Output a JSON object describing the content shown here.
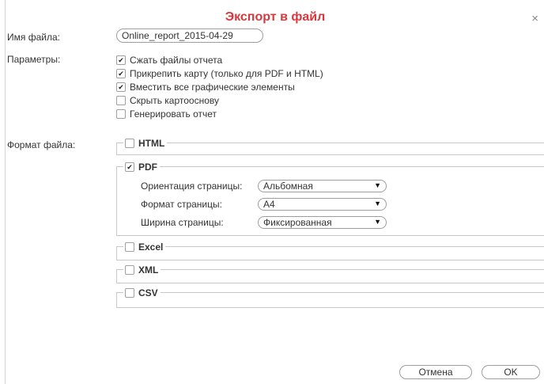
{
  "dialog": {
    "title": "Экспорт в файл",
    "close_symbol": "×"
  },
  "file_name": {
    "label": "Имя файла:",
    "value": "Online_report_2015-04-29"
  },
  "parameters": {
    "label": "Параметры:",
    "options": [
      {
        "label": "Сжать файлы отчета",
        "checked": true
      },
      {
        "label": "Прикрепить карту (только для PDF и HTML)",
        "checked": true
      },
      {
        "label": "Вместить все графические элементы",
        "checked": true
      },
      {
        "label": "Скрыть картооснову",
        "checked": false
      },
      {
        "label": "Генерировать отчет",
        "checked": false
      }
    ]
  },
  "format": {
    "label": "Формат файла:",
    "html": {
      "label": "HTML",
      "checked": false
    },
    "pdf": {
      "label": "PDF",
      "checked": true,
      "orientation": {
        "label": "Ориентация страницы:",
        "value": "Альбомная"
      },
      "page_format": {
        "label": "Формат страницы:",
        "value": "A4"
      },
      "page_width": {
        "label": "Ширина страницы:",
        "value": "Фиксированная"
      }
    },
    "excel": {
      "label": "Excel",
      "checked": false
    },
    "xml": {
      "label": "XML",
      "checked": false
    },
    "csv": {
      "label": "CSV",
      "checked": false
    }
  },
  "buttons": {
    "cancel": "Отмена",
    "ok": "OK"
  },
  "icons": {
    "check_mark": "✔",
    "dropdown_arrow": "▼"
  },
  "colors": {
    "title": "#d9383d",
    "border": "#9e9e9e"
  }
}
